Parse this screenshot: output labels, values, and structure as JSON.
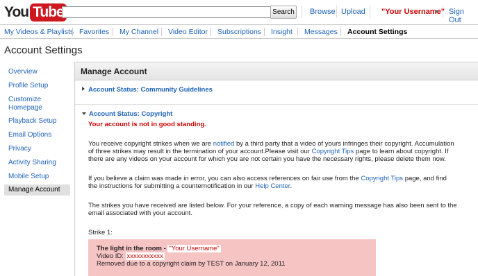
{
  "header": {
    "logo_you": "You",
    "logo_tube": "Tube",
    "search_placeholder": "",
    "search_button": "Search",
    "browse": "Browse",
    "upload": "Upload",
    "username": "\"Your Username\"",
    "signout": "Sign Out"
  },
  "nav": {
    "items": [
      {
        "label": "My Videos & Playlists"
      },
      {
        "label": "Favorites"
      },
      {
        "label": "My Channel"
      },
      {
        "label": "Video Editor"
      },
      {
        "label": "Subscriptions"
      },
      {
        "label": "Insight"
      },
      {
        "label": "Messages"
      },
      {
        "label": "Account Settings"
      }
    ]
  },
  "page_title": "Account Settings",
  "sidebar": {
    "items": [
      {
        "label": "Overview"
      },
      {
        "label": "Profile Setup"
      },
      {
        "label": "Customize Homepage"
      },
      {
        "label": "Playback Setup"
      },
      {
        "label": "Email Options"
      },
      {
        "label": "Privacy"
      },
      {
        "label": "Activity Sharing"
      },
      {
        "label": "Mobile Setup"
      },
      {
        "label": "Manage Account"
      }
    ]
  },
  "main": {
    "title": "Manage Account",
    "section_community": "Account Status: Community Guidelines",
    "section_copyright": "Account Status: Copyright",
    "warning": "Your account is not in good standing.",
    "p1_a": "You receive copyright strikes when we are ",
    "p1_link": "notified",
    "p1_b": " by a third party that a video of yours infringes their copyright. Accumulation of three strikes may result in the termination of your account.Please visit our ",
    "p1_link2": "Copyright Tips",
    "p1_c": " page to learn about copyright. If there are any videos on your account for which you are not certain you have the necessary rights, please delete them now.",
    "p2_a": "If you believe a claim was made in error, you can also access references on fair use from the ",
    "p2_link": "Copyright Tips",
    "p2_b": " page, and find the instructions for submitting a counternotification in our ",
    "p2_link2": "Help Center",
    "p2_c": ".",
    "p3": "The strikes you have received are listed below. For your reference, a copy of each warning message has also been sent to the email associated with your account.",
    "strike_label": "Strike 1:",
    "strike_title": "The light in the room - ",
    "strike_user": "\"Your Username\"",
    "strike_vid_label": "Video ID: ",
    "strike_vid": "xxxxxxxxxxx",
    "strike_removed": "Removed due to a copyright claim by TEST on January 12, 2011"
  },
  "colors": {
    "brand_red": "#cc181e",
    "link": "#1c62b9",
    "warning": "#cc0000",
    "strike_bg": "#f7c4c4"
  }
}
